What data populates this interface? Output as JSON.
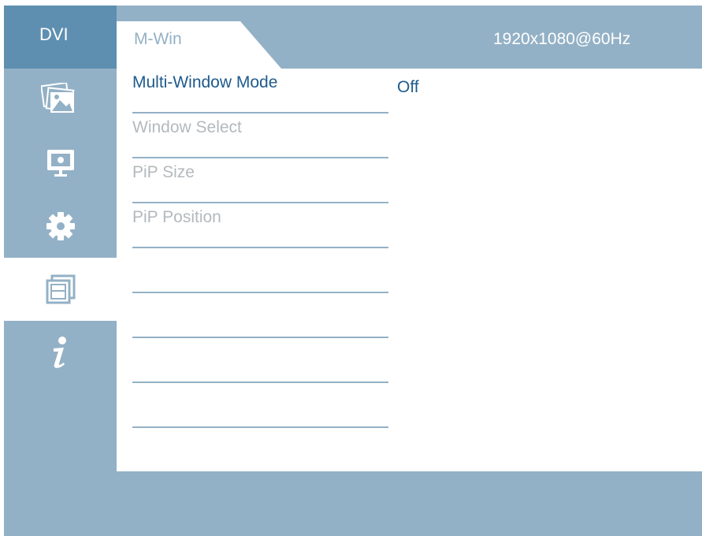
{
  "header": {
    "input_source": "DVI",
    "tab_label": "M-Win",
    "resolution": "1920x1080@60Hz"
  },
  "sidebar": {
    "items": [
      {
        "icon": "picture-icon",
        "active": false
      },
      {
        "icon": "display-icon",
        "active": false
      },
      {
        "icon": "gear-icon",
        "active": false
      },
      {
        "icon": "multi-window-icon",
        "active": true
      },
      {
        "icon": "info-icon",
        "active": false
      }
    ]
  },
  "menu": {
    "items": [
      {
        "label": "Multi-Window Mode",
        "state": "selected"
      },
      {
        "label": "Window Select",
        "state": "disabled"
      },
      {
        "label": "PiP Size",
        "state": "disabled"
      },
      {
        "label": "PiP Position",
        "state": "disabled"
      },
      {
        "label": ""
      },
      {
        "label": ""
      },
      {
        "label": ""
      },
      {
        "label": ""
      },
      {
        "label": ""
      }
    ],
    "selected_value": "Off"
  },
  "colors": {
    "frame": "#93b1c6",
    "input_label_bg": "#5e8fb0",
    "active_text": "#1e5a8c",
    "disabled_text": "#b4b9bd",
    "panel": "#ffffff"
  }
}
